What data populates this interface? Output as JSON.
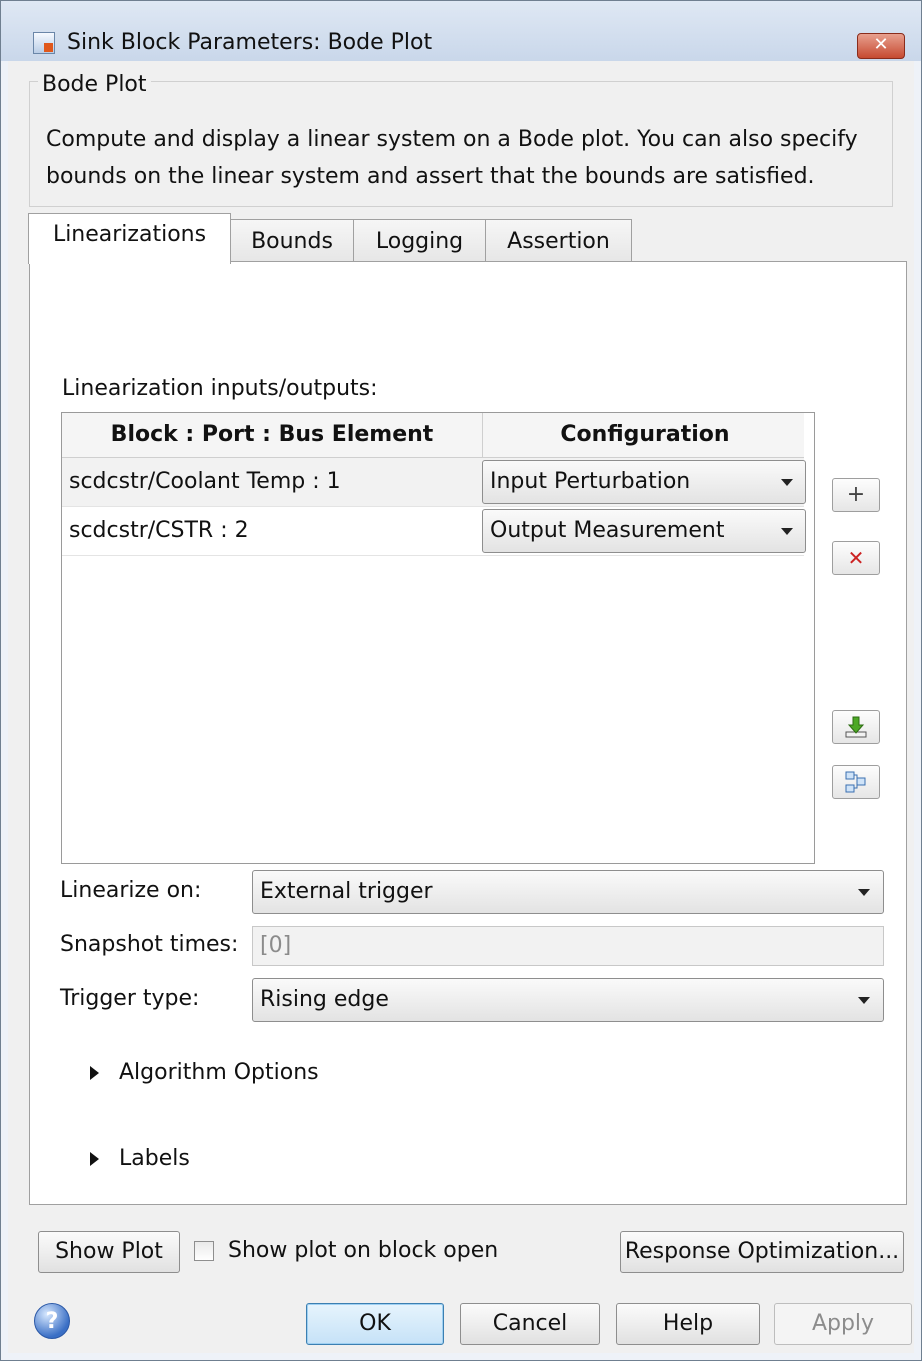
{
  "window": {
    "title": "Sink Block Parameters: Bode Plot",
    "close_glyph": "✕"
  },
  "group": {
    "label": "Bode Plot",
    "description": "Compute and display a linear system on a Bode plot. You can also specify bounds on the linear system and assert that the bounds are satisfied."
  },
  "tabs": [
    {
      "label": "Linearizations",
      "active": true
    },
    {
      "label": "Bounds"
    },
    {
      "label": "Logging"
    },
    {
      "label": "Assertion"
    }
  ],
  "linearizations": {
    "section_label": "Linearization inputs/outputs:",
    "table": {
      "headers": [
        "Block : Port : Bus Element",
        "Configuration"
      ],
      "rows": [
        {
          "block": "scdcstr/Coolant Temp : 1",
          "configuration": "Input Perturbation"
        },
        {
          "block": "scdcstr/CSTR : 2",
          "configuration": "Output Measurement"
        }
      ]
    },
    "side_buttons": {
      "add_glyph": "+",
      "remove_glyph": "✕"
    },
    "linearize_on": {
      "label": "Linearize on:",
      "value": "External trigger"
    },
    "snapshot_times": {
      "label": "Snapshot times:",
      "value": "[0]"
    },
    "trigger_type": {
      "label": "Trigger type:",
      "value": "Rising edge"
    },
    "expanders": [
      "Algorithm Options",
      "Labels"
    ]
  },
  "bottom": {
    "show_plot": "Show Plot",
    "show_plot_on_open": "Show plot on block open",
    "show_plot_on_open_checked": false,
    "response_optimization": "Response Optimization...",
    "help_glyph": "?",
    "ok": "OK",
    "cancel": "Cancel",
    "help": "Help",
    "apply": "Apply"
  }
}
